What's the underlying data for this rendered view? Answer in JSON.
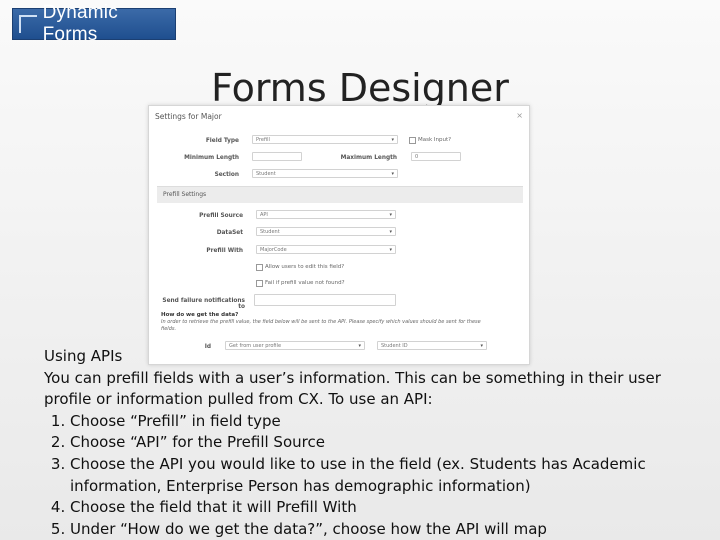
{
  "logo": {
    "text": "Dynamic Forms"
  },
  "slide_title": "Forms Designer",
  "dialog": {
    "title": "Settings for Major",
    "close": "×",
    "field_type_label": "Field Type",
    "field_type_value": "Prefill",
    "mask_input_label": "Mask Input?",
    "min_length_label": "Minimum Length",
    "max_length_label": "Maximum Length",
    "max_length_value": "0",
    "section_label": "Section",
    "section_value": "Student",
    "prefill_section": "Prefill Settings",
    "prefill_source_label": "Prefill Source",
    "prefill_source_value": "API",
    "dataset_label": "DataSet",
    "dataset_value": "Student",
    "prefill_with_label": "Prefill With",
    "prefill_with_value": "MajorCode",
    "allow_edit_label": "Allow users to edit this field?",
    "fail_prefill_label": "Fail if prefill value not found?",
    "send_failure_label": "Send failure notifications to",
    "how_label": "How do we get the data?",
    "how_desc": "In order to retrieve the prefill value, the field below will be sent to the API. Please specify which values should be sent for these fields.",
    "id_label": "Id",
    "id_value": "Get from user profile",
    "id_second_value": "Student ID"
  },
  "body": {
    "heading": "Using APIs",
    "intro": "You can prefill fields with a user’s information.  This can be something in their user profile or information pulled from CX.  To use an API:",
    "steps": [
      "Choose “Prefill” in field type",
      "Choose “API” for the Prefill Source",
      "Choose the API you would like to use in the field (ex. Students has Academic information, Enterprise Person has demographic information)",
      "Choose the field that it will Prefill With",
      "Under “How do we get the data?”, choose how the API will map"
    ]
  }
}
